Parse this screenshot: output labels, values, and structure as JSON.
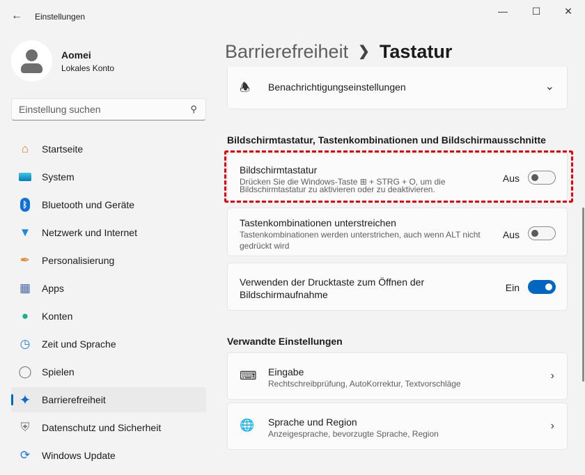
{
  "window": {
    "title": "Einstellungen",
    "back_icon": "arrow-left-icon"
  },
  "user": {
    "name": "Aomei",
    "account": "Lokales Konto"
  },
  "search": {
    "placeholder": "Einstellung suchen"
  },
  "nav": [
    {
      "label": "Startseite",
      "icon": "home-icon"
    },
    {
      "label": "System",
      "icon": "system-icon"
    },
    {
      "label": "Bluetooth und Geräte",
      "icon": "bluetooth-icon"
    },
    {
      "label": "Netzwerk und Internet",
      "icon": "wifi-icon"
    },
    {
      "label": "Personalisierung",
      "icon": "brush-icon"
    },
    {
      "label": "Apps",
      "icon": "apps-icon"
    },
    {
      "label": "Konten",
      "icon": "account-icon"
    },
    {
      "label": "Zeit und Sprache",
      "icon": "clock-icon"
    },
    {
      "label": "Spielen",
      "icon": "gamepad-icon"
    },
    {
      "label": "Barrierefreiheit",
      "icon": "accessibility-icon",
      "selected": true
    },
    {
      "label": "Datenschutz und Sicherheit",
      "icon": "shield-icon"
    },
    {
      "label": "Windows Update",
      "icon": "update-icon"
    }
  ],
  "header": {
    "parent": "Barrierefreiheit",
    "current": "Tastatur"
  },
  "notifications": {
    "label": "Benachrichtigungseinstellungen"
  },
  "section1": "Bildschirmtastatur, Tastenkombinationen und Bildschirmausschnitte",
  "settings": [
    {
      "title": "Bildschirmtastatur",
      "desc1": "Drücken Sie die Windows-Taste ⊞ + STRG + O, um die",
      "desc2": "Bildschirmtastatur zu aktivieren oder zu deaktivieren.",
      "state": "Aus",
      "on": false
    },
    {
      "title": "Tastenkombinationen unterstreichen",
      "desc1": "Tastenkombinationen werden unterstrichen, auch wenn ALT nicht",
      "desc2": "gedrückt wird",
      "state": "Aus",
      "on": false
    },
    {
      "title1": "Verwenden der Drucktaste zum Öffnen der",
      "title2": "Bildschirmaufnahme",
      "state": "Ein",
      "on": true
    }
  ],
  "section2": "Verwandte Einstellungen",
  "related": [
    {
      "title": "Eingabe",
      "desc": "Rechtschreibprüfung, AutoKorrektur, Textvorschläge"
    },
    {
      "title": "Sprache und Region",
      "desc": "Anzeigesprache, bevorzugte Sprache, Region"
    }
  ],
  "colors": {
    "accent": "#0067c0",
    "highlight": "#e8000b"
  }
}
